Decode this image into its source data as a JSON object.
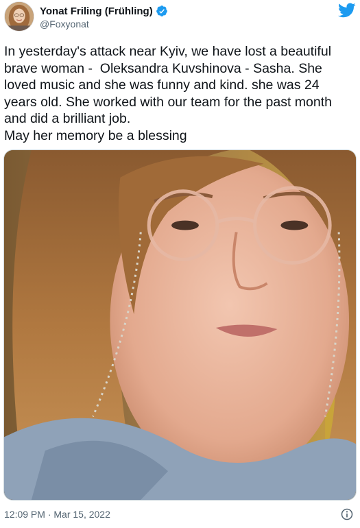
{
  "author": {
    "display_name": "Yonat Friling (Frühling)",
    "handle": "@Foxyonat",
    "verified": true
  },
  "tweet": {
    "text": "In yesterday's attack near Kyiv, we have lost a beautiful brave woman -  Oleksandra Kuvshinova - Sasha. She loved music and she was funny and kind. she was 24 years old. She worked with our team for the past month and did a brilliant job.\nMay her memory be a blessing",
    "timestamp": "12:09 PM · Mar 15, 2022"
  },
  "icons": {
    "verified": "verified-badge-icon",
    "brand": "twitter-bird-icon",
    "info": "info-icon"
  },
  "colors": {
    "brand_blue": "#1d9bf0",
    "text_primary": "#0f1419",
    "text_secondary": "#536471",
    "border": "#cfd9de"
  }
}
